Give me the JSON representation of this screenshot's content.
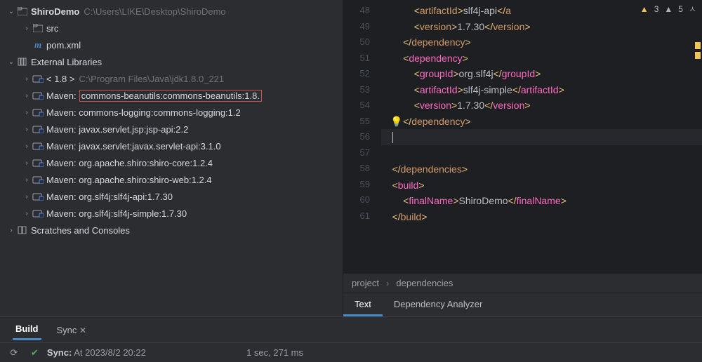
{
  "project": {
    "name": "ShiroDemo",
    "path": "C:\\Users\\LIKE\\Desktop\\ShiroDemo",
    "children": [
      {
        "icon": "folder",
        "label": "src"
      },
      {
        "icon": "maven",
        "label": "pom.xml"
      }
    ]
  },
  "external_libraries": {
    "label": "External Libraries",
    "items": [
      {
        "label": "< 1.8 >",
        "path": "C:\\Program Files\\Java\\jdk1.8.0_221"
      },
      {
        "label": "Maven: commons-beanutils:commons-beanutils:1.8.",
        "highlight": true
      },
      {
        "label": "Maven: commons-logging:commons-logging:1.2"
      },
      {
        "label": "Maven: javax.servlet.jsp:jsp-api:2.2"
      },
      {
        "label": "Maven: javax.servlet:javax.servlet-api:3.1.0"
      },
      {
        "label": "Maven: org.apache.shiro:shiro-core:1.2.4"
      },
      {
        "label": "Maven: org.apache.shiro:shiro-web:1.2.4"
      },
      {
        "label": "Maven: org.slf4j:slf4j-api:1.7.30"
      },
      {
        "label": "Maven: org.slf4j:slf4j-simple:1.7.30"
      }
    ]
  },
  "scratches": "Scratches and Consoles",
  "warnings": {
    "yellow_count": "3",
    "grey_count": "5"
  },
  "gutter": [
    "48",
    "49",
    "50",
    "51",
    "52",
    "53",
    "54",
    "55",
    "56",
    "57",
    "58",
    "59",
    "60",
    "61"
  ],
  "code": {
    "l48": {
      "open": "<",
      "tag": "artifactId",
      "close": ">",
      "txt": "slf4j-api",
      "copen": "</",
      "ctag": "artifactId"
    },
    "l49": {
      "open": "<",
      "tag": "version",
      "close": ">",
      "txt": "1.7.30",
      "copen": "</",
      "ctag": "version"
    },
    "l50": {
      "copen": "</",
      "ctag": "dependency",
      "close": ">"
    },
    "l51": {
      "open": "<",
      "tag": "dependency",
      "close": ">"
    },
    "l52": {
      "open": "<",
      "tag": "groupId",
      "close": ">",
      "txt": "org.slf4j",
      "copen": "</",
      "ctag": "groupId"
    },
    "l53": {
      "open": "<",
      "tag": "artifactId",
      "close": ">",
      "txt": "slf4j-simple",
      "copen": "</",
      "ctag": "artifactId"
    },
    "l54": {
      "open": "<",
      "tag": "version",
      "close": ">",
      "txt": "1.7.30",
      "copen": "</",
      "ctag": "version"
    },
    "l55": {
      "copen": "</",
      "ctag": "dependency",
      "close": ">"
    },
    "l58": {
      "copen": "</",
      "ctag": "dependencies",
      "close": ">"
    },
    "l59": {
      "open": "<",
      "tag": "build",
      "close": ">"
    },
    "l60": {
      "open": "<",
      "tag": "finalName",
      "close": ">",
      "txt": "ShiroDemo",
      "copen": "</",
      "ctag": "finalName"
    },
    "l61": {
      "copen": "</",
      "ctag": "build",
      "close": ">"
    }
  },
  "breadcrumbs": [
    "project",
    "dependencies"
  ],
  "sub_tabs": [
    "Text",
    "Dependency Analyzer"
  ],
  "bottom_tabs": [
    "Build",
    "Sync"
  ],
  "sync": {
    "label": "Sync:",
    "msg": "At 2023/8/2 20:22",
    "duration": "1 sec, 271 ms"
  }
}
